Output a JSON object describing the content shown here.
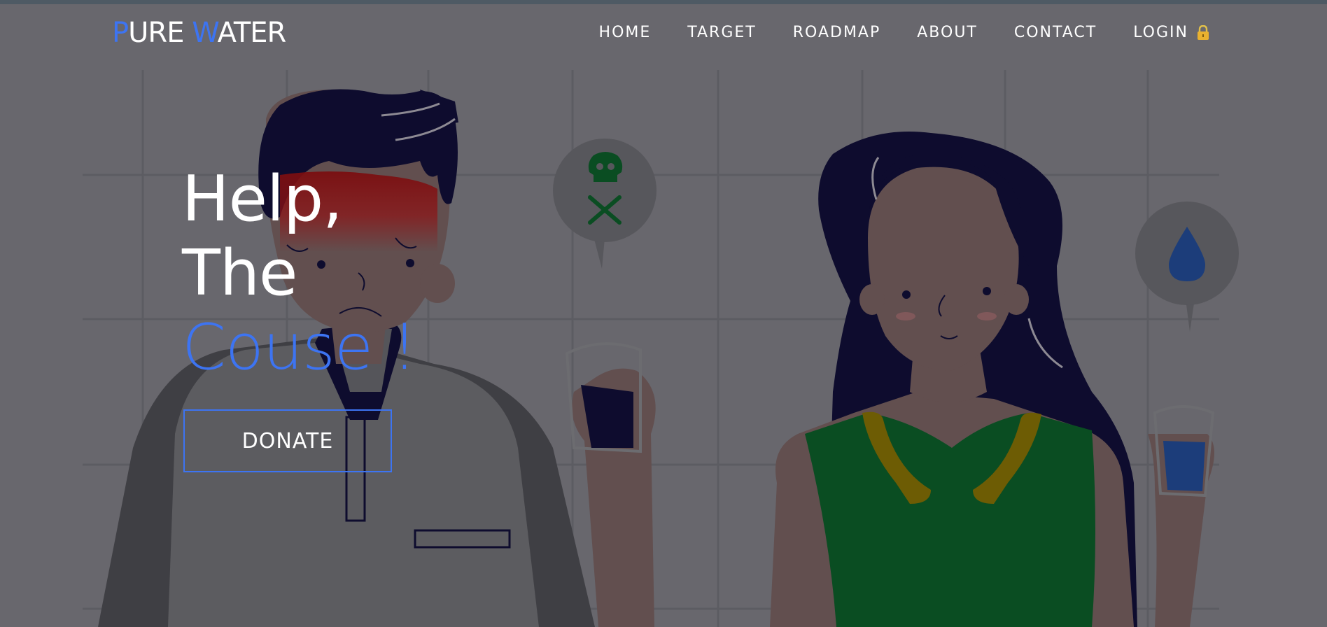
{
  "brand": {
    "logo_first_initial": "P",
    "logo_first_rest": "URE",
    "logo_second_initial": "W",
    "logo_second_rest": "ATER"
  },
  "nav": {
    "items": [
      {
        "label": "HOME"
      },
      {
        "label": "TARGET"
      },
      {
        "label": "ROADMAP"
      },
      {
        "label": "ABOUT"
      },
      {
        "label": "CONTACT"
      }
    ],
    "login_label": "LOGIN"
  },
  "hero": {
    "line1": "Help,",
    "line2": "The",
    "line3": "Couse !",
    "donate_label": "DONATE"
  },
  "colors": {
    "accent": "#3d74f2",
    "overlay": "#67676d",
    "text": "#ffffff"
  },
  "icons": [
    "lock-icon",
    "skull-crossbones-icon",
    "water-drop-icon"
  ]
}
